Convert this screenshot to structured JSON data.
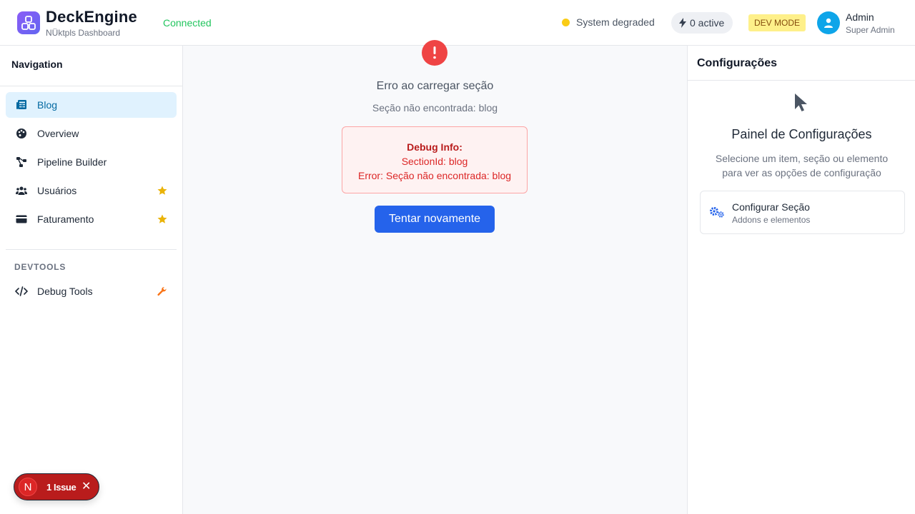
{
  "header": {
    "brand_name": "DeckEngine",
    "brand_sub": "NÜktpls Dashboard",
    "connection_status": "Connected",
    "system_status": "System degraded",
    "active_count": "0 active",
    "dev_mode_label": "DEV MODE",
    "user_name": "Admin",
    "user_role": "Super Admin"
  },
  "sidebar": {
    "title": "Navigation",
    "items": [
      {
        "label": "Blog",
        "icon": "newspaper-icon",
        "active": true
      },
      {
        "label": "Overview",
        "icon": "palette-icon"
      },
      {
        "label": "Pipeline Builder",
        "icon": "pipeline-icon"
      },
      {
        "label": "Usuários",
        "icon": "users-icon",
        "starred": true
      },
      {
        "label": "Faturamento",
        "icon": "credit-card-icon",
        "starred": true
      }
    ],
    "devtools_title": "DEVTOOLS",
    "devtools_items": [
      {
        "label": "Debug Tools",
        "icon": "code-icon",
        "badge_icon": "wrench-icon"
      }
    ]
  },
  "main": {
    "error_title": "Erro ao carregar seção",
    "error_message": "Seção não encontrada: blog",
    "debug": {
      "title": "Debug Info:",
      "section_id_line": "SectionId: blog",
      "error_line": "Error: Seção não encontrada: blog"
    },
    "retry_label": "Tentar novamente"
  },
  "right_panel": {
    "title": "Configurações",
    "heading": "Painel de Configurações",
    "description": "Selecione um item, seção ou elemento para ver as opções de configuração",
    "card": {
      "title": "Configurar Seção",
      "subtitle": "Addons e elementos"
    }
  },
  "issue_badge": {
    "letter": "N",
    "label": "1 Issue"
  },
  "colors": {
    "accent": "#2563eb",
    "connected": "#22c55e",
    "warning_dot": "#facc15",
    "error": "#ef4444",
    "active_nav_bg": "#e0f2fe"
  }
}
